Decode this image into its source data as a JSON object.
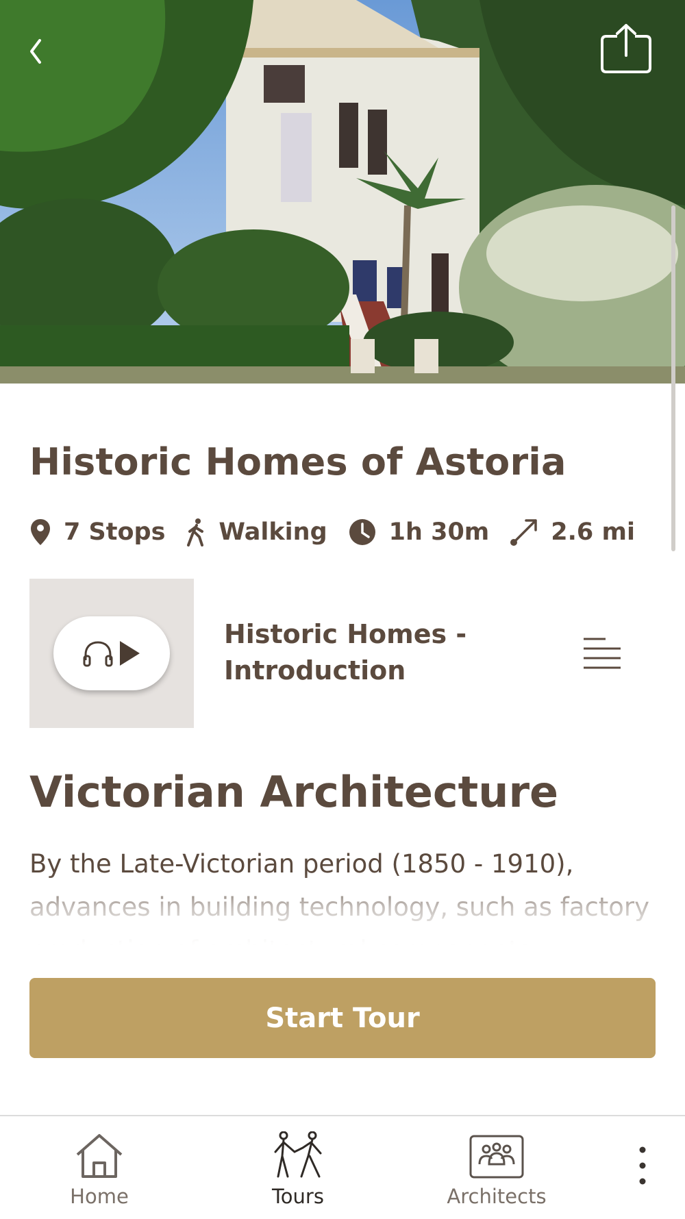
{
  "hero": {
    "alt_icon": "house-photo"
  },
  "header": {
    "back_icon": "chevron-left-icon",
    "share_icon": "share-icon"
  },
  "tour": {
    "title": "Historic Homes of Astoria",
    "stops": "7 Stops",
    "mode": "Walking",
    "duration": "1h 30m",
    "distance": "2.6 mi"
  },
  "audio": {
    "title": "Historic Homes - Introduction",
    "icons": [
      "headphones-icon",
      "play-icon",
      "playlist-icon"
    ]
  },
  "section": {
    "title": "Victorian Architecture",
    "body": "By the Late-Victorian period (1850 - 1910), advances in building technology, such as factory production of architectural components"
  },
  "actions": {
    "start_label": "Start Tour"
  },
  "tabbar": {
    "items": [
      {
        "label": "Home",
        "icon": "home-icon",
        "active": false
      },
      {
        "label": "Tours",
        "icon": "walking-couple-icon",
        "active": true
      },
      {
        "label": "Architects",
        "icon": "group-icon",
        "active": false
      }
    ],
    "more_icon": "more-vertical-icon"
  },
  "colors": {
    "text": "#5b4a3e",
    "accent": "#bea063",
    "audio_bg": "#e6e2df"
  }
}
